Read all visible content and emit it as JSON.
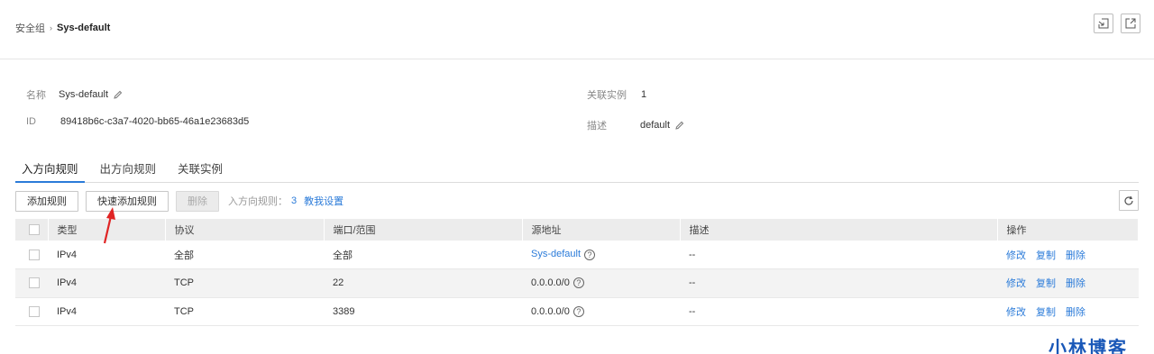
{
  "breadcrumb": {
    "root": "安全组",
    "current": "Sys-default"
  },
  "info": {
    "name_label": "名称",
    "name_value": "Sys-default",
    "id_label": "ID",
    "id_value": "89418b6c-c3a7-4020-bb65-46a1e23683d5",
    "linked_label": "关联实例",
    "linked_value": "1",
    "desc_label": "描述",
    "desc_value": "default"
  },
  "tabs": [
    "入方向规则",
    "出方向规则",
    "关联实例"
  ],
  "toolbar": {
    "add_rule": "添加规则",
    "quick_add_rule": "快速添加规则",
    "delete": "删除",
    "count_label": "入方向规则：",
    "count_value": "3",
    "help_link": "教我设置"
  },
  "table": {
    "headers": [
      "类型",
      "协议",
      "端口/范围",
      "源地址",
      "描述",
      "操作"
    ],
    "rows": [
      {
        "type": "IPv4",
        "protocol": "全部",
        "port": "全部",
        "source": "Sys-default",
        "source_is_link": true,
        "desc": "--"
      },
      {
        "type": "IPv4",
        "protocol": "TCP",
        "port": "22",
        "source": "0.0.0.0/0",
        "source_is_link": false,
        "desc": "--"
      },
      {
        "type": "IPv4",
        "protocol": "TCP",
        "port": "3389",
        "source": "0.0.0.0/0",
        "source_is_link": false,
        "desc": "--"
      }
    ],
    "actions": [
      "修改",
      "复制",
      "删除"
    ]
  },
  "watermark": "小林博客",
  "colors": {
    "link": "#2b7bd9",
    "tab_active": "#2b7bd9",
    "arrow": "#e02424",
    "watermark": "#1a58b8"
  },
  "icons": {
    "top_left_action": "import-icon",
    "top_right_action": "export-icon",
    "refresh": "refresh-icon",
    "edit": "pencil-icon",
    "help": "question-circle-icon"
  }
}
